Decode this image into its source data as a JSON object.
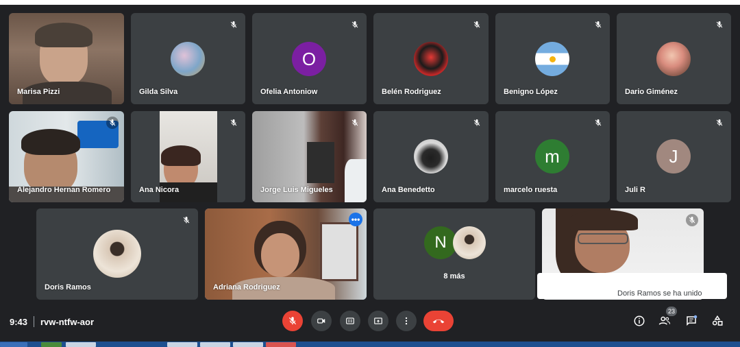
{
  "participants": [
    {
      "name": "Marisa Pizzi"
    },
    {
      "name": "Gilda Silva"
    },
    {
      "name": "Ofelia Antoniow",
      "initial": "O",
      "color": "#7b1fa2"
    },
    {
      "name": "Belén Rodriguez"
    },
    {
      "name": "Benigno López"
    },
    {
      "name": "Dario Giménez"
    },
    {
      "name": "Alejandro Hernan Romero"
    },
    {
      "name": "Ana Nicora"
    },
    {
      "name": "Jorge Luis Migueles"
    },
    {
      "name": "Ana Benedetto"
    },
    {
      "name": "marcelo ruesta",
      "initial": "m",
      "color": "#2e7d32"
    },
    {
      "name": "Juli R",
      "initial": "J",
      "color": "#a1887f"
    },
    {
      "name": "Doris Ramos"
    },
    {
      "name": "Adriana Rodriguez"
    }
  ],
  "others_tile": {
    "initial": "N",
    "color": "#33691e",
    "label": "8 más"
  },
  "toast": {
    "text": "Doris Ramos se ha unido"
  },
  "meeting": {
    "time": "9:43",
    "code": "rvw-ntfw-aor"
  },
  "people_count": "23",
  "icons": [
    "mic-off-icon",
    "camera-icon",
    "captions-icon",
    "present-icon",
    "more-options-icon",
    "end-call-icon",
    "info-icon",
    "people-icon",
    "chat-icon",
    "activities-icon"
  ]
}
